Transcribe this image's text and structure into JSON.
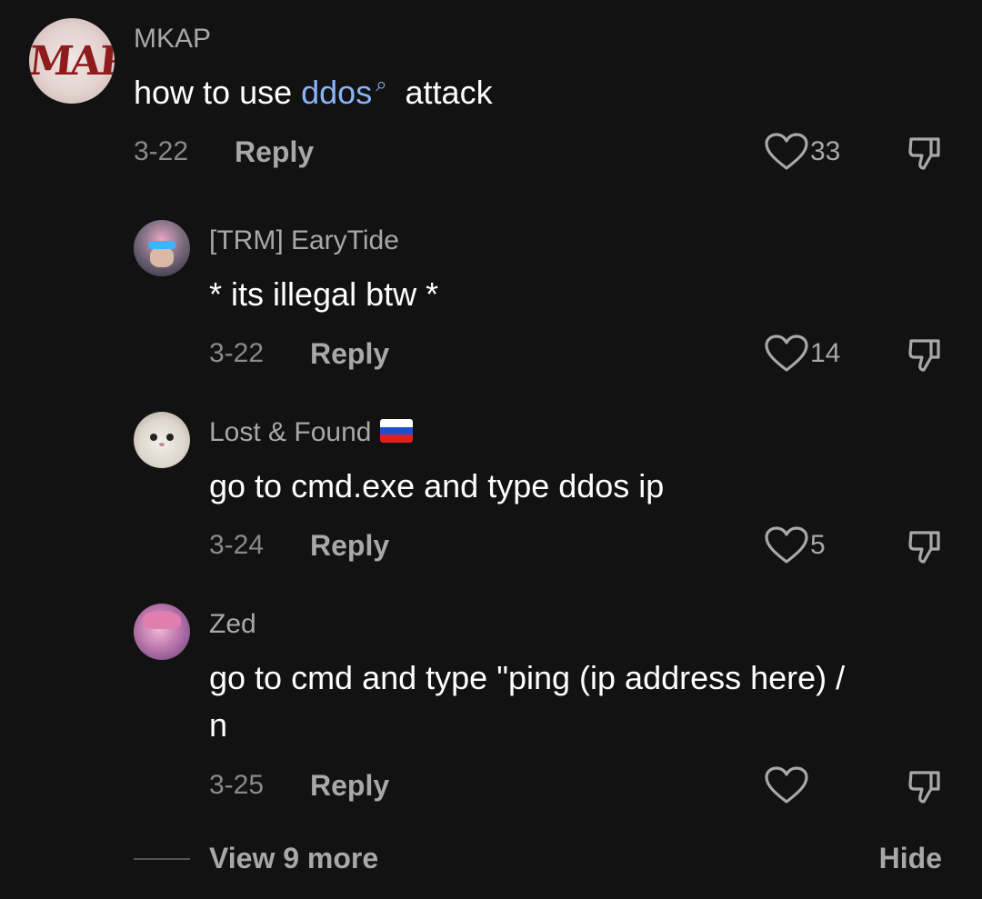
{
  "comments": [
    {
      "username": "MKAP",
      "text_before": "how to use ",
      "link": "ddos",
      "text_after": "  attack",
      "date": "3-22",
      "reply": "Reply",
      "likes": "33",
      "avatar_text": "MAP"
    },
    {
      "username": "[TRM] EaryTide",
      "text": "* its illegal btw *",
      "date": "3-22",
      "reply": "Reply",
      "likes": "14"
    },
    {
      "username": "Lost & Found",
      "text": "go to cmd.exe and type ddos ip",
      "date": "3-24",
      "reply": "Reply",
      "likes": "5",
      "flag_colors": [
        "#ffffff",
        "#1f4fd1",
        "#e02020"
      ]
    },
    {
      "username": "Zed",
      "text_line1": "go to cmd and type \"ping (ip address here) /",
      "text_line2": "n",
      "date": "3-25",
      "reply": "Reply",
      "likes": ""
    }
  ],
  "footer": {
    "view_more": "View 9 more",
    "hide": "Hide"
  },
  "icons": {
    "like": "heart-outline-icon",
    "dislike": "thumbs-down-icon",
    "search": "search-icon"
  },
  "colors": {
    "background": "#121212",
    "link": "#8ab4f8",
    "secondary_text": "#a8a8a8"
  }
}
